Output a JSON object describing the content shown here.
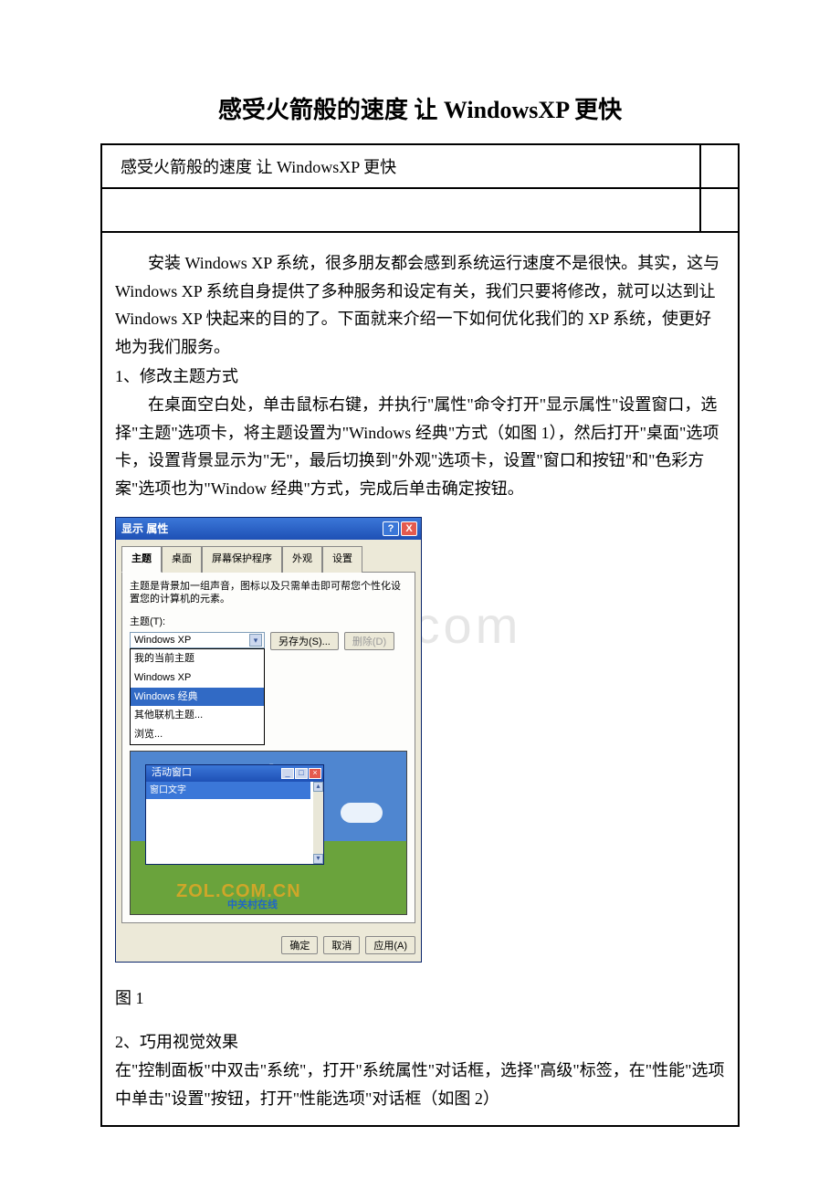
{
  "title": "感受火箭般的速度 让 WindowsXP 更快",
  "header_cell": "感受火箭般的速度 让 WindowsXP 更快",
  "background_watermark": "cx.com",
  "body": {
    "p1": "安装 Windows XP 系统，很多朋友都会感到系统运行速度不是很快。其实，这与 Windows XP 系统自身提供了多种服务和设定有关，我们只要将修改，就可以达到让 Windows XP 快起来的目的了。下面就来介绍一下如何优化我们的 XP 系统，使更好地为我们服务。",
    "s1": "1、修改主题方式",
    "p2": "在桌面空白处，单击鼠标右键，并执行\"属性\"命令打开\"显示属性\"设置窗口，选择\"主题\"选项卡，将主题设置为\"Windows 经典\"方式（如图 1），然后打开\"桌面\"选项卡，设置背景显示为\"无\"，最后切换到\"外观\"选项卡，设置\"窗口和按钮\"和\"色彩方案\"选项也为\"Window 经典\"方式，完成后单击确定按钮。",
    "figure1_caption": "图 1",
    "s2": "2、巧用视觉效果",
    "p3": "在\"控制面板\"中双击\"系统\"，打开\"系统属性\"对话框，选择\"高级\"标签，在\"性能\"选项中单击\"设置\"按钮，打开\"性能选项\"对话框（如图 2）"
  },
  "dialog": {
    "title": "显示 属性",
    "help": "?",
    "close": "X",
    "tabs": [
      "主题",
      "桌面",
      "屏幕保护程序",
      "外观",
      "设置"
    ],
    "hint": "主题是背景加一组声音，图标以及只需单击即可帮您个性化设置您的计算机的元素。",
    "theme_label": "主题(T):",
    "combo_value": "Windows XP",
    "save_as": "另存为(S)...",
    "delete": "删除(D)",
    "options": [
      "我的当前主题",
      "Windows XP",
      "Windows 经典",
      "其他联机主题...",
      "浏览..."
    ],
    "selected_option_index": 2,
    "mini_window_title": "活动窗口",
    "mini_label": "窗口文字",
    "watermark": "ZOL.COM.CN",
    "watermark2": "中关村在线",
    "ok": "确定",
    "cancel": "取消",
    "apply": "应用(A)"
  }
}
